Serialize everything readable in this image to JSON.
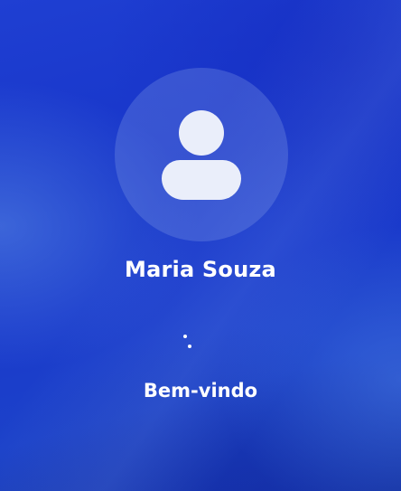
{
  "login": {
    "user_name": "Maria Souza",
    "status_text": "Bem-vindo",
    "avatar_icon": "user-silhouette-icon",
    "spinner_icon": "loading-spinner-icon"
  },
  "colors": {
    "background": "#1538c8",
    "text": "#ffffff",
    "avatar_glyph": "#eaeefa"
  }
}
